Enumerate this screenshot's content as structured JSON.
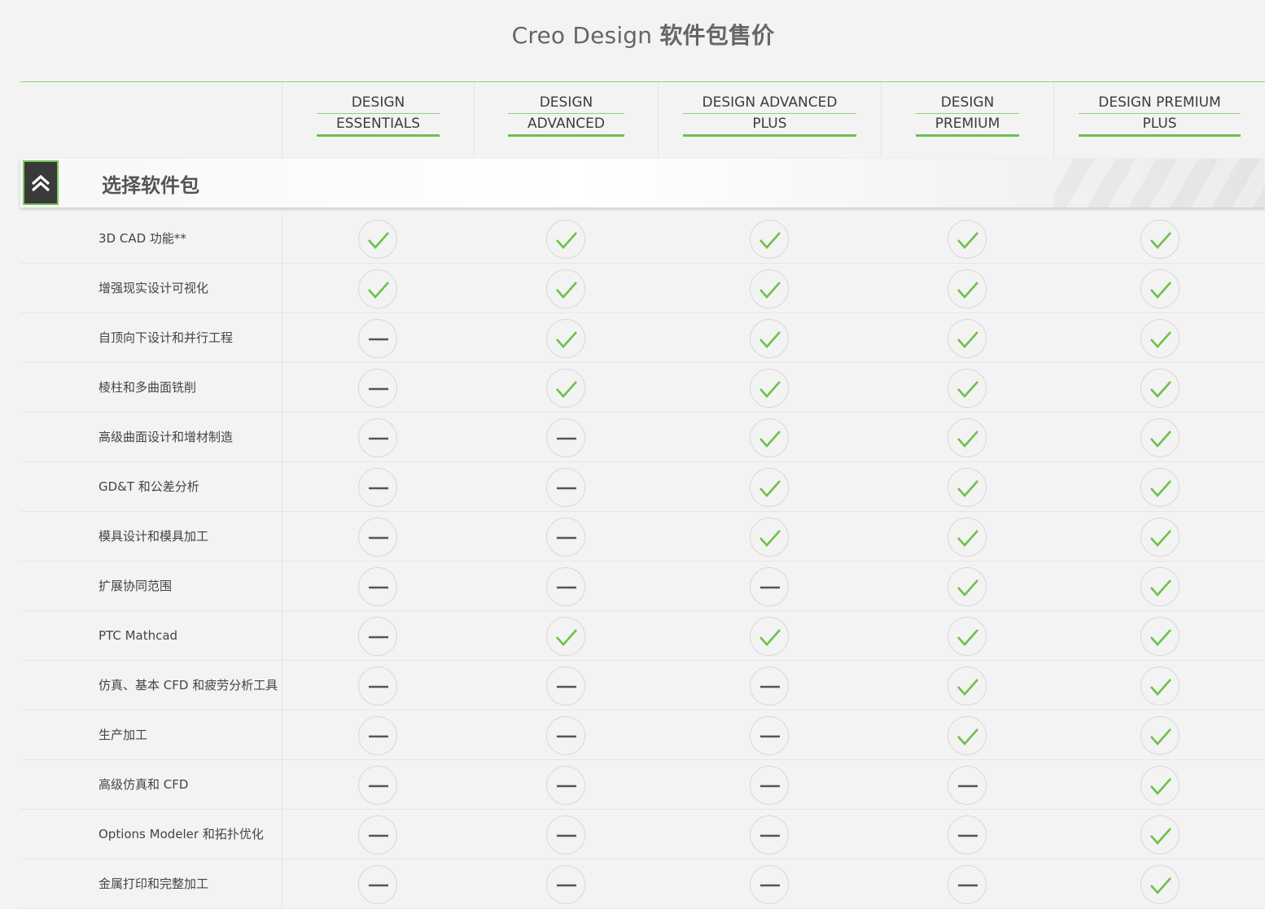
{
  "title": {
    "main": "Creo Design",
    "bold": "软件包售价"
  },
  "columns": [
    {
      "line1": "DESIGN",
      "line2": "ESSENTIALS"
    },
    {
      "line1": "DESIGN",
      "line2": "ADVANCED"
    },
    {
      "line1": "DESIGN ADVANCED",
      "line2": "PLUS"
    },
    {
      "line1": "DESIGN",
      "line2": "PREMIUM"
    },
    {
      "line1": "DESIGN PREMIUM",
      "line2": "PLUS"
    }
  ],
  "section": {
    "title": "选择软件包",
    "icon": "chevron-double-up-icon"
  },
  "colors": {
    "accent": "#6cc24a",
    "dash": "#555555"
  },
  "rows": [
    {
      "feature": "3D CAD 功能**",
      "values": [
        true,
        true,
        true,
        true,
        true
      ]
    },
    {
      "feature": "增强现实设计可视化",
      "values": [
        true,
        true,
        true,
        true,
        true
      ]
    },
    {
      "feature": "自顶向下设计和并行工程",
      "values": [
        false,
        true,
        true,
        true,
        true
      ]
    },
    {
      "feature": "棱柱和多曲面铣削",
      "values": [
        false,
        true,
        true,
        true,
        true
      ]
    },
    {
      "feature": "高级曲面设计和增材制造",
      "values": [
        false,
        false,
        true,
        true,
        true
      ]
    },
    {
      "feature": "GD&T 和公差分析",
      "values": [
        false,
        false,
        true,
        true,
        true
      ]
    },
    {
      "feature": "模具设计和模具加工",
      "values": [
        false,
        false,
        true,
        true,
        true
      ]
    },
    {
      "feature": "扩展协同范围",
      "values": [
        false,
        false,
        false,
        true,
        true
      ]
    },
    {
      "feature": "PTC Mathcad",
      "values": [
        false,
        true,
        true,
        true,
        true
      ]
    },
    {
      "feature": "仿真、基本 CFD 和疲劳分析工具",
      "values": [
        false,
        false,
        false,
        true,
        true
      ]
    },
    {
      "feature": "生产加工",
      "values": [
        false,
        false,
        false,
        true,
        true
      ]
    },
    {
      "feature": "高级仿真和 CFD",
      "values": [
        false,
        false,
        false,
        false,
        true
      ]
    },
    {
      "feature": "Options Modeler 和拓扑优化",
      "values": [
        false,
        false,
        false,
        false,
        true
      ]
    },
    {
      "feature": "金属打印和完整加工",
      "values": [
        false,
        false,
        false,
        false,
        true
      ]
    }
  ]
}
